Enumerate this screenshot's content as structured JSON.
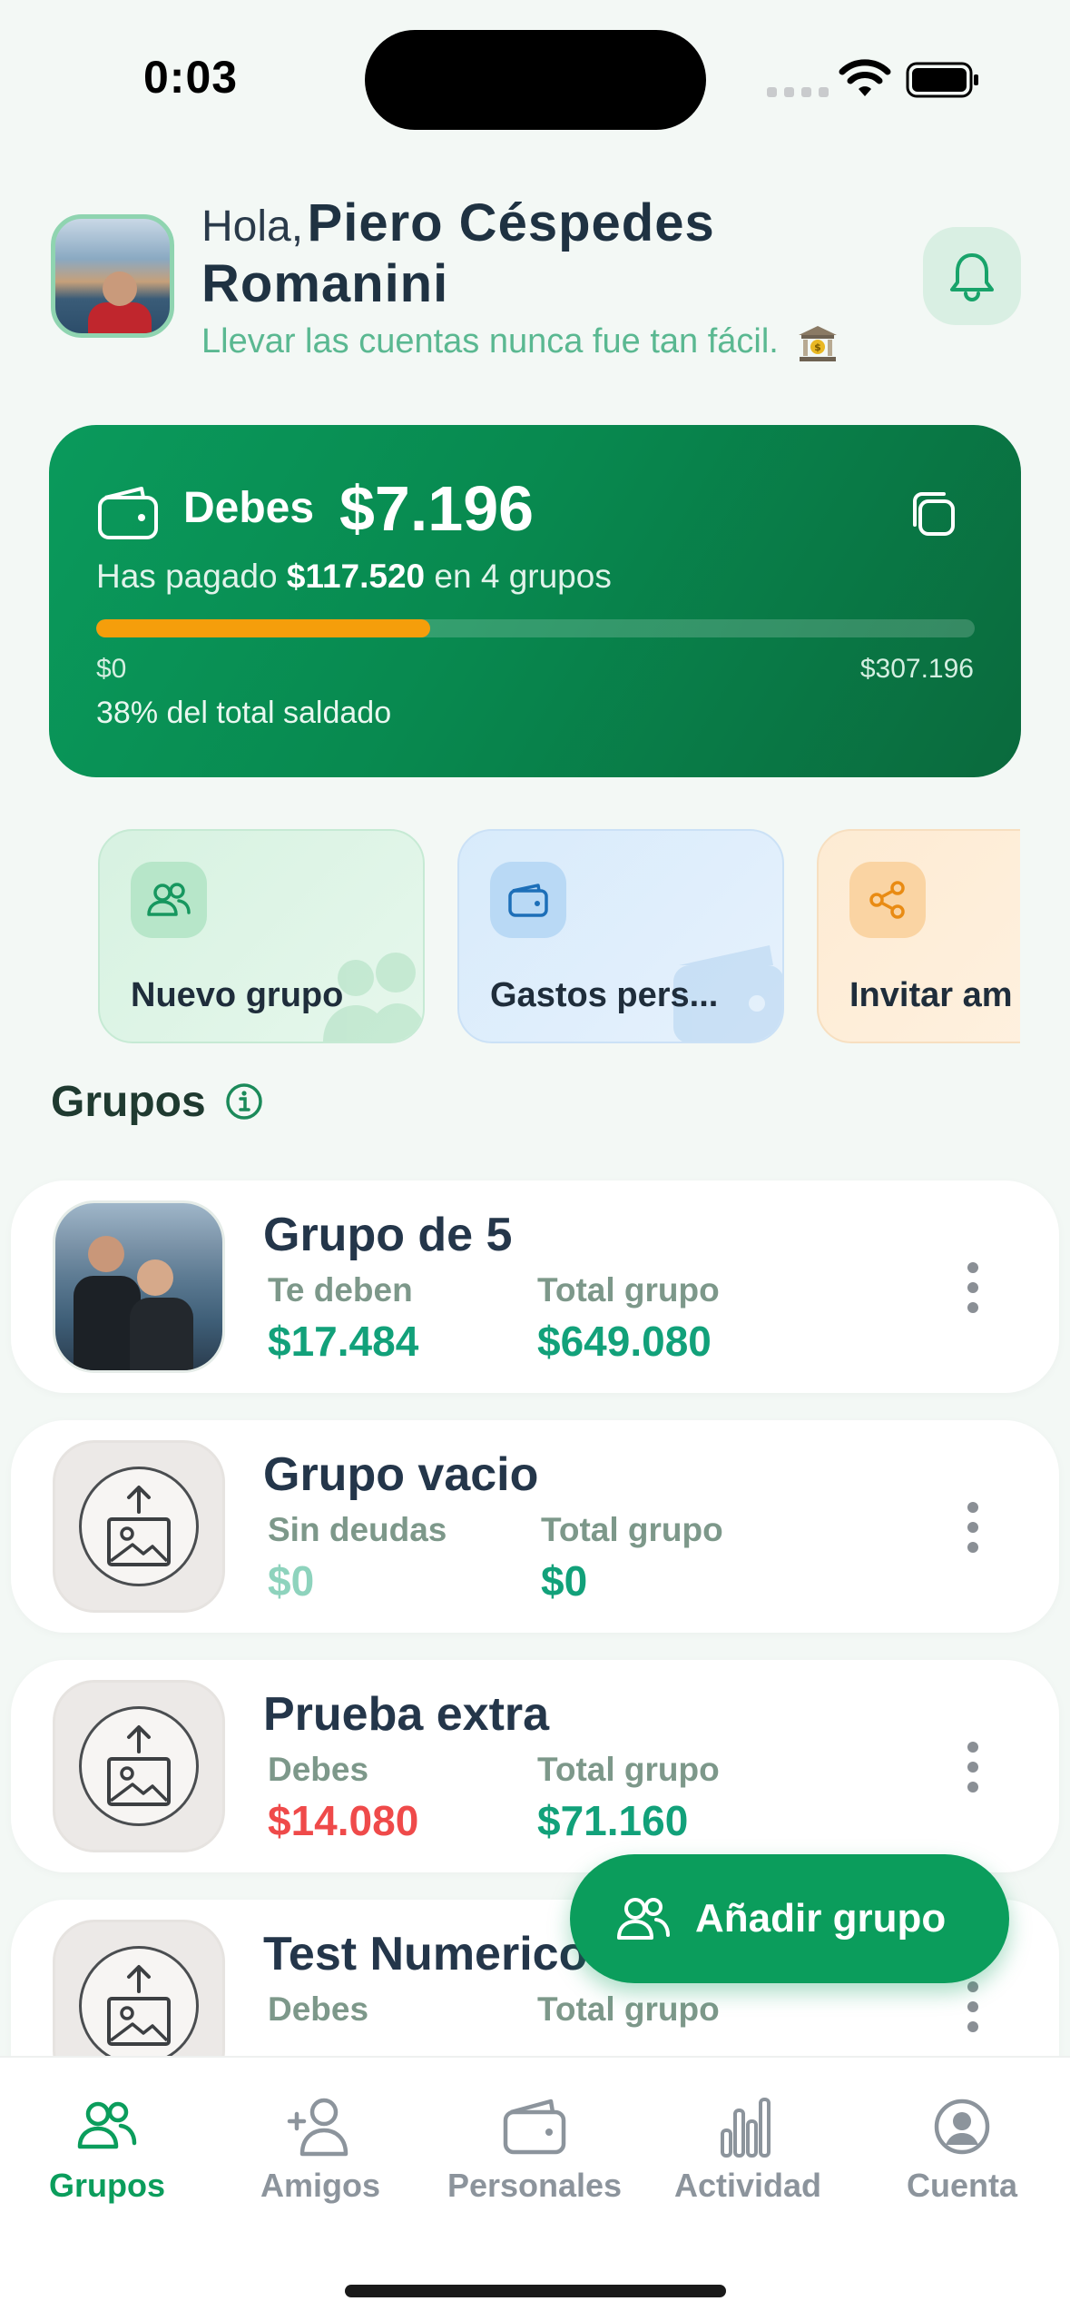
{
  "status": {
    "time": "0:03"
  },
  "header": {
    "hola": "Hola,",
    "name_line1": "Piero Céspedes",
    "name_line2": "Romanini",
    "tagline": "Llevar las cuentas nunca fue tan fácil."
  },
  "balance": {
    "debes_label": "Debes",
    "debes_amount": "$7.196",
    "paid_prefix": "Has pagado",
    "paid_amount": "$117.520",
    "paid_suffix": "en 4 grupos",
    "progress_fraction": 0.38,
    "min_label": "$0",
    "max_label": "$307.196",
    "pct_text": "38% del total saldado",
    "progress_color": "#f59e0b"
  },
  "quick_actions": [
    {
      "label": "Nuevo grupo",
      "icon": "users-icon"
    },
    {
      "label": "Gastos pers...",
      "icon": "wallet-icon"
    },
    {
      "label": "Invitar am",
      "icon": "share-icon"
    }
  ],
  "groups_section": {
    "title": "Grupos"
  },
  "groups": [
    {
      "name": "Grupo de 5",
      "label1": "Te deben",
      "value1": "$17.484",
      "label2": "Total grupo",
      "value2": "$649.080"
    },
    {
      "name": "Grupo vacio",
      "label1": "Sin deudas",
      "value1": "$0",
      "label2": "Total grupo",
      "value2": "$0"
    },
    {
      "name": "Prueba extra",
      "label1": "Debes",
      "value1": "$14.080",
      "label2": "Total grupo",
      "value2": "$71.160"
    },
    {
      "name": "Test Numerico",
      "label1": "Debes",
      "value1": "",
      "label2": "Total grupo",
      "value2": ""
    }
  ],
  "fab": {
    "label": "Añadir grupo"
  },
  "tabs": [
    {
      "label": "Grupos",
      "icon": "users-icon",
      "active": true
    },
    {
      "label": "Amigos",
      "icon": "add-user-icon",
      "active": false
    },
    {
      "label": "Personales",
      "icon": "wallet-icon",
      "active": false
    },
    {
      "label": "Actividad",
      "icon": "bar-chart-icon",
      "active": false
    },
    {
      "label": "Cuenta",
      "icon": "account-icon",
      "active": false
    }
  ],
  "colors": {
    "brand_green": "#0b9d5c",
    "debt_red": "#ef4a4a",
    "positive_green": "#12a17a"
  }
}
